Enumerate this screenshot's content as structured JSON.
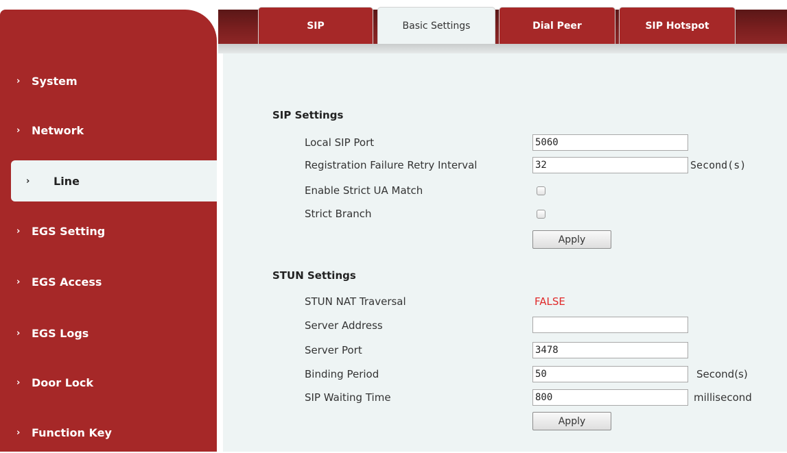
{
  "sidebar": {
    "items": [
      {
        "label": "System"
      },
      {
        "label": "Network"
      },
      {
        "label": "Line"
      },
      {
        "label": "EGS Setting"
      },
      {
        "label": "EGS Access"
      },
      {
        "label": "EGS Logs"
      },
      {
        "label": "Door Lock"
      },
      {
        "label": "Function Key"
      }
    ],
    "active": "Line"
  },
  "tabs": [
    {
      "label": "SIP"
    },
    {
      "label": "Basic Settings"
    },
    {
      "label": "Dial Peer"
    },
    {
      "label": "SIP Hotspot"
    }
  ],
  "active_tab": "Basic Settings",
  "sip_settings": {
    "title": "SIP Settings",
    "local_sip_port": {
      "label": "Local SIP Port",
      "value": "5060"
    },
    "retry_interval": {
      "label": "Registration Failure Retry Interval",
      "value": "32",
      "unit": "Second(s)"
    },
    "strict_ua_match": {
      "label": "Enable Strict UA Match",
      "checked": false
    },
    "strict_branch": {
      "label": "Strict Branch",
      "checked": false
    },
    "apply_label": "Apply"
  },
  "stun_settings": {
    "title": "STUN Settings",
    "nat_traversal": {
      "label": "STUN NAT Traversal",
      "value": "FALSE"
    },
    "server_address": {
      "label": "Server Address",
      "value": ""
    },
    "server_port": {
      "label": "Server Port",
      "value": "3478"
    },
    "binding_period": {
      "label": "Binding Period",
      "value": "50",
      "unit": "Second(s)"
    },
    "sip_waiting_time": {
      "label": "SIP Waiting Time",
      "value": "800",
      "unit": "millisecond"
    },
    "apply_label": "Apply"
  },
  "colors": {
    "brand_red": "#a62828",
    "content_bg": "#eef4f4",
    "false_text": "#e02a2a"
  }
}
